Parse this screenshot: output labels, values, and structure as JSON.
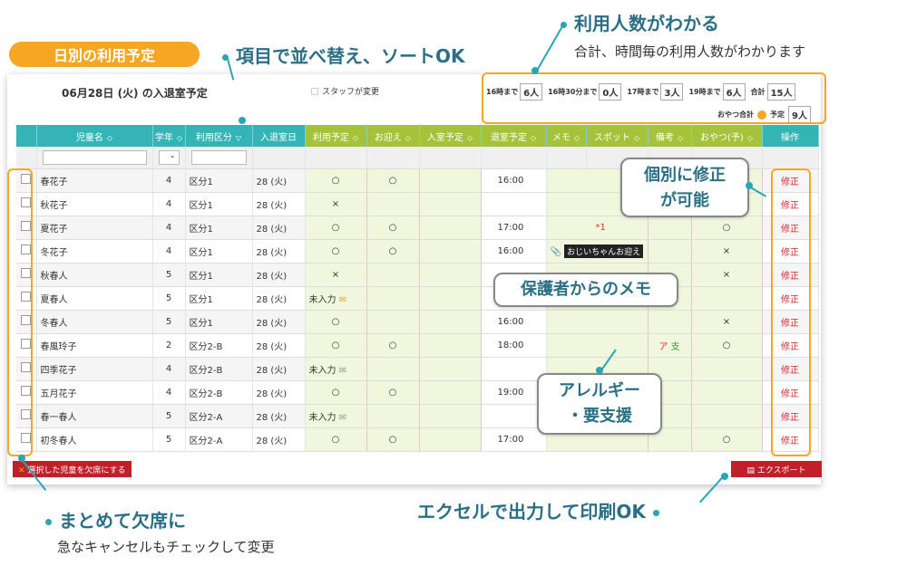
{
  "badge": "日別の利用予定",
  "callouts": {
    "sort": "項目で並べ替え、ソートOK",
    "count_title": "利用人数がわかる",
    "count_sub": "合計、時間毎の利用人数がわかります",
    "absent_title": "まとめて欠席に",
    "absent_sub": "急なキャンセルもチェックして変更",
    "export": "エクセルで出力して印刷OK",
    "edit": "個別に修正が可能",
    "edit_l1": "個別に修正",
    "edit_l2": "が可能",
    "memo": "保護者からのメモ",
    "allergy_l1": "アレルギー",
    "allergy_l2": "・要支援"
  },
  "panel": {
    "title": "06月28日 (火) の入退室予定",
    "staff_changed": "スタッフが変更",
    "counts": [
      {
        "label": "16時まで",
        "value": "6人"
      },
      {
        "label": "16時30分まで",
        "value": "0人"
      },
      {
        "label": "17時まで",
        "value": "3人"
      },
      {
        "label": "19時まで",
        "value": "6人"
      },
      {
        "label": "合計",
        "value": "15人"
      }
    ],
    "oyatsu_label": "おやつ合計",
    "oyatsu_plan_label": "予定",
    "oyatsu_plan_value": "9人"
  },
  "table": {
    "headers": [
      "児童名",
      "学年",
      "利用区分",
      "入退室日",
      "利用予定",
      "お迎え",
      "入室予定",
      "退室予定",
      "メモ",
      "スポット",
      "備考",
      "おやつ(予)",
      "操作"
    ],
    "edit_label": "修正",
    "rows": [
      {
        "name": "春花子",
        "grade": "4",
        "kubun": "区分1",
        "date": "28 (火)",
        "plan": "○",
        "pickup": "○",
        "in": "",
        "out": "16:00",
        "memo": "",
        "spot": "",
        "note": "",
        "snack": ""
      },
      {
        "name": "秋花子",
        "grade": "4",
        "kubun": "区分1",
        "date": "28 (火)",
        "plan": "×",
        "pickup": "",
        "in": "",
        "out": "",
        "memo": "",
        "spot": "",
        "note": "",
        "snack": ""
      },
      {
        "name": "夏花子",
        "grade": "4",
        "kubun": "区分1",
        "date": "28 (火)",
        "plan": "○",
        "pickup": "○",
        "in": "",
        "out": "17:00",
        "memo": "",
        "spot": "*1",
        "note": "",
        "snack": "○"
      },
      {
        "name": "冬花子",
        "grade": "4",
        "kubun": "区分1",
        "date": "28 (火)",
        "plan": "○",
        "pickup": "○",
        "in": "",
        "out": "16:00",
        "memo": "おじいちゃんお迎え",
        "spot": "",
        "note": "",
        "snack": "×"
      },
      {
        "name": "秋春人",
        "grade": "5",
        "kubun": "区分1",
        "date": "28 (火)",
        "plan": "×",
        "pickup": "",
        "in": "",
        "out": "",
        "memo": "",
        "spot": "",
        "note": "",
        "snack": "×"
      },
      {
        "name": "夏春人",
        "grade": "5",
        "kubun": "区分1",
        "date": "28 (火)",
        "plan": "未入力",
        "pickup": "",
        "in": "",
        "out": "",
        "memo": "",
        "spot": "",
        "note": "",
        "snack": ""
      },
      {
        "name": "冬春人",
        "grade": "5",
        "kubun": "区分1",
        "date": "28 (火)",
        "plan": "○",
        "pickup": "",
        "in": "",
        "out": "16:00",
        "memo": "",
        "spot": "",
        "note": "",
        "snack": "×"
      },
      {
        "name": "春風玲子",
        "grade": "2",
        "kubun": "区分2-B",
        "date": "28 (火)",
        "plan": "○",
        "pickup": "○",
        "in": "",
        "out": "18:00",
        "memo": "",
        "spot": "",
        "note": "ア 支",
        "snack": "○"
      },
      {
        "name": "四季花子",
        "grade": "4",
        "kubun": "区分2-B",
        "date": "28 (火)",
        "plan": "未入力",
        "pickup": "",
        "in": "",
        "out": "",
        "memo": "",
        "spot": "",
        "note": "",
        "snack": ""
      },
      {
        "name": "五月花子",
        "grade": "4",
        "kubun": "区分2-B",
        "date": "28 (火)",
        "plan": "○",
        "pickup": "○",
        "in": "",
        "out": "19:00",
        "memo": "",
        "spot": "",
        "note": "",
        "snack": ""
      },
      {
        "name": "春一春人",
        "grade": "5",
        "kubun": "区分2-A",
        "date": "28 (火)",
        "plan": "未入力",
        "pickup": "",
        "in": "",
        "out": "",
        "memo": "",
        "spot": "",
        "note": "",
        "snack": ""
      },
      {
        "name": "初冬春人",
        "grade": "5",
        "kubun": "区分2-A",
        "date": "28 (火)",
        "plan": "○",
        "pickup": "○",
        "in": "",
        "out": "17:00",
        "memo": "",
        "spot": "",
        "note": "",
        "snack": "○"
      }
    ]
  },
  "buttons": {
    "absent": "選択した児童を欠席にする",
    "export": "エクスポート"
  },
  "colors": {
    "accent_orange": "#f5a623",
    "header_teal": "#35b4b6",
    "header_green": "#a5c33a",
    "callout_teal": "#2b6f86",
    "button_red": "#c0202a"
  }
}
